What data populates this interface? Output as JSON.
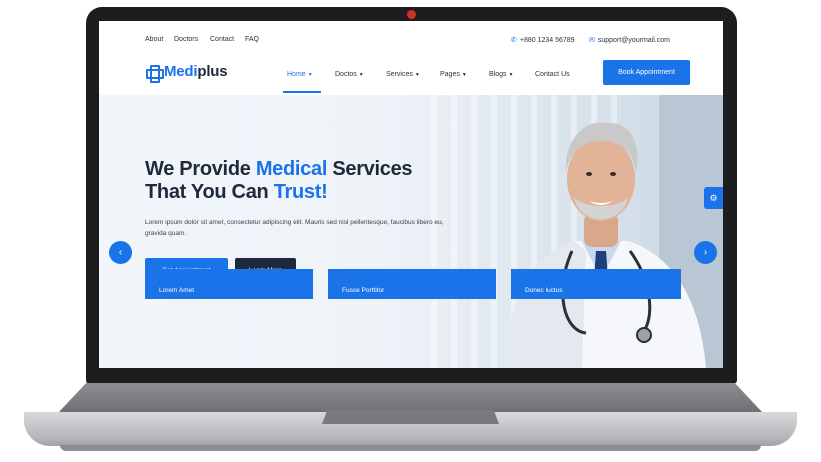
{
  "topbar": {
    "links": [
      "About",
      "Doctors",
      "Contact",
      "FAQ"
    ],
    "phone": "+880 1234 56789",
    "email": "support@yourmail.com",
    "phone_icon": "phone-icon",
    "email_icon": "mail-icon"
  },
  "navbar": {
    "logo_prefix": "Medi",
    "logo_suffix": "plus",
    "menu": [
      "Home",
      "Doctos",
      "Services",
      "Pages",
      "Blogs",
      "Contact Us"
    ],
    "active_item": "Home",
    "cta": "Book Appointment"
  },
  "hero": {
    "headline_1a": "We Provide ",
    "headline_1b": "Medical",
    "headline_1c": " Services",
    "headline_2a": "That You Can ",
    "headline_2b": "Trust!",
    "subtext": "Lorem ipsum dolor sit amet, consectetur adipiscing elit. Mauris sed nisl pellentesque, faucibus libero eu, gravida quam.",
    "primary_button": "Get Appointment",
    "secondary_button": "Learn More"
  },
  "cards": [
    "Lorem Amet",
    "Fusce Porttitor",
    "Donec luctus"
  ],
  "colors": {
    "accent": "#1a73e8",
    "dark": "#1e2a3b",
    "camera": "#c0392b"
  }
}
